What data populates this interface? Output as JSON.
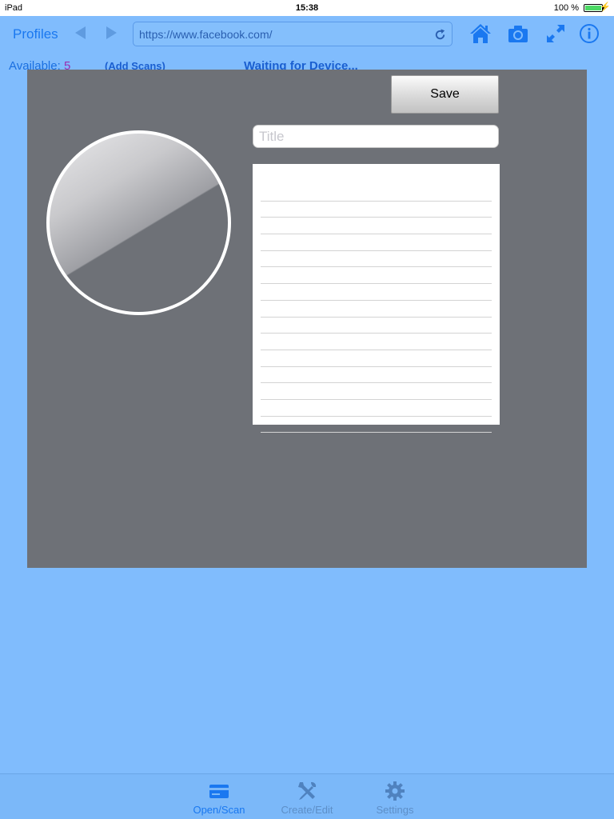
{
  "status_bar": {
    "device": "iPad",
    "time": "15:38",
    "battery": "100 %"
  },
  "toolbar": {
    "profiles_label": "Profiles",
    "url": "https://www.facebook.com/",
    "icons": [
      "back-arrow-icon",
      "forward-arrow-icon",
      "reload-icon",
      "home-icon",
      "camera-icon",
      "expand-icon",
      "info-icon"
    ]
  },
  "info_line": {
    "available_label": "Available:",
    "available_count": "5",
    "add_scans": "(Add Scans)",
    "device_status": "Waiting for Device..."
  },
  "modal": {
    "save_label": "Save",
    "title_placeholder": "Title",
    "title_value": "",
    "notes_lines": 15
  },
  "tab_bar": {
    "tabs": [
      {
        "label": "Open/Scan",
        "icon": "card-icon",
        "selected": true
      },
      {
        "label": "Create/Edit",
        "icon": "tools-icon",
        "selected": false
      },
      {
        "label": "Settings",
        "icon": "gear-icon",
        "selected": false
      }
    ]
  },
  "colors": {
    "background": "#80bcfd",
    "modal": "#6e7177",
    "accent": "#1a78f0",
    "count": "#9a2eb0"
  }
}
